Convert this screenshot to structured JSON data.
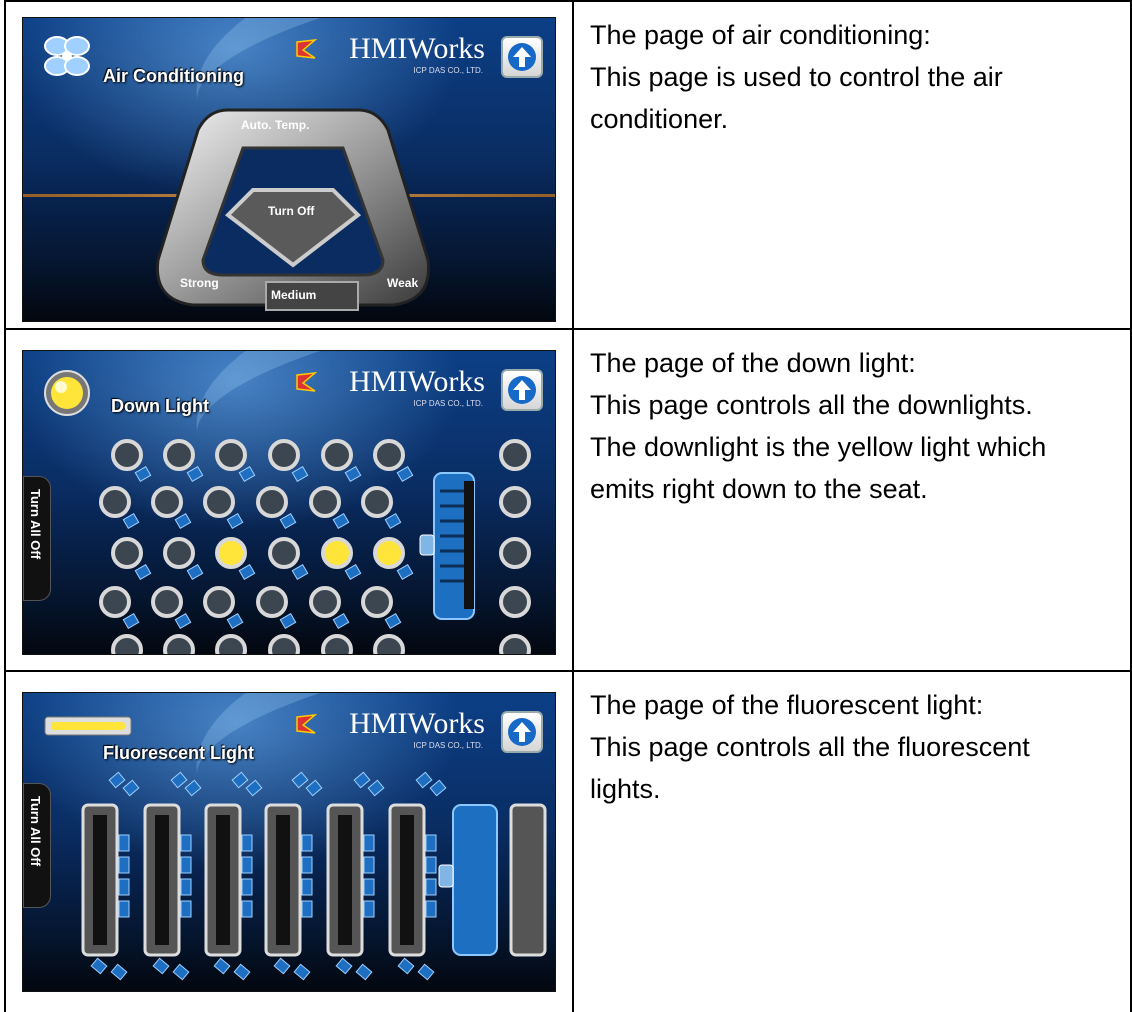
{
  "rows": [
    {
      "screen": {
        "title": "Air Conditioning",
        "brand": "HMIWorks",
        "brand_sub": "ICP DAS CO., LTD.",
        "buttons": {
          "auto_temp": "Auto. Temp.",
          "turn_off": "Turn Off",
          "strong": "Strong",
          "medium": "Medium",
          "weak": "Weak"
        }
      },
      "desc": [
        "The page of air conditioning:",
        "This page is used to control the air",
        "conditioner."
      ]
    },
    {
      "screen": {
        "title": "Down Light",
        "brand": "HMIWorks",
        "brand_sub": "ICP DAS CO., LTD.",
        "turn_all_off": "Turn All Off",
        "lights_on_row3": [
          3,
          5,
          6
        ]
      },
      "desc": [
        "The page of the down light:",
        "This page controls all the downlights.",
        "The downlight is the yellow light which",
        "emits right down to the seat."
      ]
    },
    {
      "screen": {
        "title": "Fluorescent Light",
        "brand": "HMIWorks",
        "brand_sub": "ICP DAS CO., LTD.",
        "turn_all_off": "Turn All Off"
      },
      "desc": [
        "The page of the fluorescent light:",
        "This page controls all the fluorescent",
        "lights."
      ]
    }
  ]
}
